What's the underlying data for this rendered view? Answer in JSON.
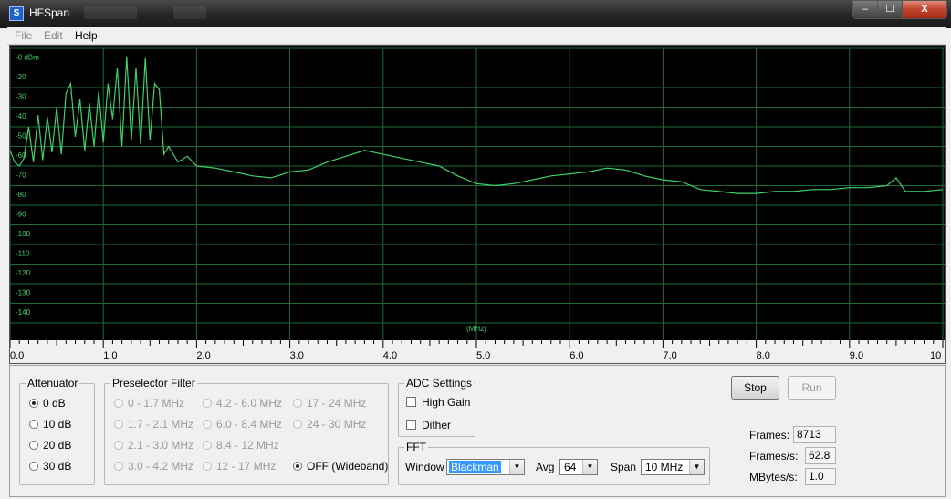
{
  "window": {
    "title": "HFSpan",
    "min_glyph": "–",
    "max_glyph": "☐",
    "close_glyph": "X"
  },
  "menu": {
    "file": "File",
    "edit": "Edit",
    "help": "Help"
  },
  "spectrum": {
    "y_labels": [
      "-0 dBm",
      "-20",
      "-30",
      "-40",
      "-50",
      "-60",
      "-70",
      "-80",
      "-90",
      "-100",
      "-110",
      "-120",
      "-130",
      "-140"
    ],
    "x_labels": [
      "0.0",
      "1.0",
      "2.0",
      "3.0",
      "4.0",
      "5.0",
      "6.0",
      "7.0",
      "8.0",
      "9.0",
      "10"
    ],
    "x_unit": "(MHz)",
    "trace_color": "#3fd06a",
    "grid_color": "#1e6b3a",
    "trace_dbm": [
      [
        0.0,
        -62
      ],
      [
        0.05,
        -68
      ],
      [
        0.1,
        -70
      ],
      [
        0.15,
        -66
      ],
      [
        0.2,
        -50
      ],
      [
        0.25,
        -68
      ],
      [
        0.3,
        -44
      ],
      [
        0.35,
        -67
      ],
      [
        0.4,
        -45
      ],
      [
        0.45,
        -63
      ],
      [
        0.5,
        -40
      ],
      [
        0.55,
        -64
      ],
      [
        0.6,
        -33
      ],
      [
        0.65,
        -28
      ],
      [
        0.7,
        -55
      ],
      [
        0.75,
        -36
      ],
      [
        0.8,
        -62
      ],
      [
        0.85,
        -38
      ],
      [
        0.9,
        -60
      ],
      [
        0.95,
        -32
      ],
      [
        1.0,
        -58
      ],
      [
        1.05,
        -28
      ],
      [
        1.1,
        -46
      ],
      [
        1.15,
        -20
      ],
      [
        1.2,
        -60
      ],
      [
        1.25,
        -14
      ],
      [
        1.3,
        -57
      ],
      [
        1.35,
        -20
      ],
      [
        1.4,
        -59
      ],
      [
        1.45,
        -15
      ],
      [
        1.5,
        -57
      ],
      [
        1.55,
        -28
      ],
      [
        1.6,
        -31
      ],
      [
        1.65,
        -64
      ],
      [
        1.7,
        -60
      ],
      [
        1.8,
        -68
      ],
      [
        1.9,
        -65
      ],
      [
        2.0,
        -70
      ],
      [
        2.2,
        -71
      ],
      [
        2.4,
        -73
      ],
      [
        2.6,
        -75
      ],
      [
        2.8,
        -76
      ],
      [
        3.0,
        -73
      ],
      [
        3.2,
        -72
      ],
      [
        3.4,
        -68
      ],
      [
        3.6,
        -65
      ],
      [
        3.8,
        -62
      ],
      [
        4.0,
        -64
      ],
      [
        4.2,
        -66
      ],
      [
        4.4,
        -68
      ],
      [
        4.6,
        -70
      ],
      [
        4.8,
        -75
      ],
      [
        5.0,
        -79
      ],
      [
        5.2,
        -80
      ],
      [
        5.4,
        -79
      ],
      [
        5.6,
        -77
      ],
      [
        5.8,
        -75
      ],
      [
        6.0,
        -74
      ],
      [
        6.2,
        -73
      ],
      [
        6.4,
        -71
      ],
      [
        6.6,
        -72
      ],
      [
        6.8,
        -75
      ],
      [
        7.0,
        -77
      ],
      [
        7.2,
        -78
      ],
      [
        7.4,
        -82
      ],
      [
        7.6,
        -83
      ],
      [
        7.8,
        -84
      ],
      [
        8.0,
        -84
      ],
      [
        8.2,
        -83
      ],
      [
        8.4,
        -83
      ],
      [
        8.6,
        -82
      ],
      [
        8.8,
        -82
      ],
      [
        9.0,
        -81
      ],
      [
        9.2,
        -81
      ],
      [
        9.4,
        -80
      ],
      [
        9.5,
        -76
      ],
      [
        9.6,
        -83
      ],
      [
        9.8,
        -83
      ],
      [
        10.0,
        -82
      ]
    ]
  },
  "attenuator": {
    "label": "Attenuator",
    "options": [
      "0 dB",
      "10 dB",
      "20 dB",
      "30 dB"
    ],
    "selected": "0 dB"
  },
  "preselector": {
    "label": "Preselector Filter",
    "col1": [
      "0 - 1.7 MHz",
      "1.7 - 2.1 MHz",
      "2.1 - 3.0 MHz",
      "3.0 - 4.2 MHz"
    ],
    "col2": [
      "4.2 - 6.0 MHz",
      "6.0 - 8.4 MHz",
      "8.4 - 12 MHz",
      "12 - 17 MHz"
    ],
    "col3": [
      "17 - 24 MHz",
      "24 - 30 MHz"
    ],
    "off": "OFF (Wideband)"
  },
  "adc": {
    "label": "ADC Settings",
    "high_gain": "High Gain",
    "dither": "Dither"
  },
  "fft": {
    "label": "FFT",
    "window_label": "Window",
    "window_value": "Blackman",
    "avg_label": "Avg",
    "avg_value": "64",
    "span_label": "Span",
    "span_value": "10 MHz"
  },
  "buttons": {
    "stop": "Stop",
    "run": "Run"
  },
  "stats": {
    "frames_label": "Frames:",
    "frames_value": "8713",
    "fps_label": "Frames/s:",
    "fps_value": "62.8",
    "mbps_label": "MBytes/s:",
    "mbps_value": "1.0"
  }
}
